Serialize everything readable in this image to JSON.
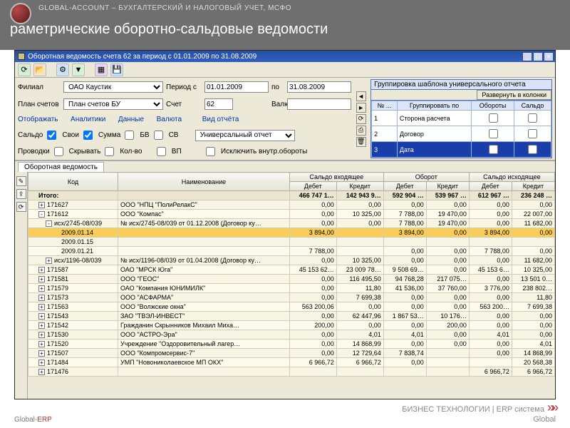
{
  "page": {
    "header": "GLOBAL-ACCOUNT – БУХГАЛТЕРСКИЙ И НАЛОГОВЫЙ УЧЕТ, МСФО",
    "title": "раметрические оборотно-сальдовые ведомости",
    "footer_left_a": "Global-",
    "footer_left_b": "ERP",
    "footer_right_a": "БИЗНЕС ТЕХНОЛОГИИ | ERP система",
    "footer_right_b": "Global"
  },
  "window": {
    "title": "Оборотная ведомость счета 62  за период с 01.01.2009 по 31.08.2009"
  },
  "filters": {
    "filial_label": "Филиал",
    "filial_value": "ОАО Каустик",
    "plan_label": "План счетов",
    "plan_value": "План счетов БУ",
    "period_s_label": "Период с",
    "period_s_value": "01.01.2009",
    "po_label": "по",
    "po_value": "31.08.2009",
    "schet_label": "Счет",
    "schet_value": "62",
    "valuta_label": "Валюта",
    "valuta_value": "",
    "otobrazhat_label": "Отображать",
    "analitiki_label": "Аналитики",
    "dannye_label": "Данные",
    "valuta2_label": "Валюта",
    "vid_otcheta_label": "Вид отчёта",
    "vid_otcheta_value": "Универсальный отчет",
    "saldo_label": "Сальдо",
    "svoi_label": "Свои",
    "summa_label": "Сумма",
    "bv_label": "БВ",
    "sv_label": "СВ",
    "provodki_label": "Проводки",
    "skryvat_label": "Скрывать",
    "kolvo_label": "Кол-во",
    "vp_label": "ВП",
    "isklyuchit_label": "Исключить внутр.обороты"
  },
  "group": {
    "title": "Группировка шаблона универсального отчета",
    "expand_btn": "Развернуть в колонки",
    "cols": {
      "no": "№ ...",
      "group_by": "Группировать по",
      "oboroty": "Обороты",
      "saldo": "Сальдо"
    },
    "rows": [
      {
        "no": "1",
        "name": "Сторона расчета",
        "ob": false,
        "sa": false,
        "sel": false
      },
      {
        "no": "2",
        "name": "Договор",
        "ob": false,
        "sa": false,
        "sel": false
      },
      {
        "no": "3",
        "name": "Дата",
        "ob": false,
        "sa": false,
        "sel": true
      }
    ]
  },
  "arrows": {
    "up": "◄",
    "down": "►",
    "refresh": "⟳",
    "export": "⎙",
    "del": "🗑"
  },
  "tab": {
    "name": "Оборотная ведомость"
  },
  "table": {
    "headers": {
      "kod": "Код",
      "naim": "Наименование",
      "saldo_in": "Сальдо входящее",
      "oborot": "Оборот",
      "saldo_out": "Сальдо исходящее",
      "debet": "Дебет",
      "kredit": "Кредит"
    },
    "rows": [
      {
        "t": "total",
        "code": "Итого:",
        "name": "",
        "d1": "466 747 1…",
        "k1": "142 943 9…",
        "d2": "592 904 …",
        "k2": "539 967 …",
        "d3": "612 967 …",
        "k3": "236 248 …"
      },
      {
        "t": "n",
        "i": 0,
        "pm": "+",
        "code": "171627",
        "name": "ООО \"НПЦ \"ПолиРелакС\"",
        "d1": "0,00",
        "k1": "0,00",
        "d2": "0,00",
        "k2": "0,00",
        "d3": "0,00",
        "k3": "0,00"
      },
      {
        "t": "n",
        "i": 0,
        "pm": "-",
        "code": "171612",
        "name": "ООО \"Компас\"",
        "d1": "0,00",
        "k1": "10 325,00",
        "d2": "7 788,00",
        "k2": "19 470,00",
        "d3": "0,00",
        "k3": "22 007,00"
      },
      {
        "t": "n",
        "i": 1,
        "pm": "-",
        "code": "исх/2745-08/039",
        "name": "№ исх/2745-08/039 от 01.12.2008 (Договор ку…",
        "d1": "0,00",
        "k1": "0,00",
        "d2": "7 788,00",
        "k2": "19 470,00",
        "d3": "0,00",
        "k3": "11 682,00"
      },
      {
        "t": "hl",
        "i": 2,
        "code": "2009.01.14",
        "name": "",
        "d1": "3 894,00",
        "k1": "",
        "d2": "3 894,00",
        "k2": "0,00",
        "d3": "3 894,00",
        "k3": "0,00"
      },
      {
        "t": "n",
        "i": 2,
        "code": "2009.01.15",
        "name": "",
        "d1": "",
        "k1": "",
        "d2": "",
        "k2": "",
        "d3": "",
        "k3": ""
      },
      {
        "t": "n",
        "i": 2,
        "code": "2009.01.21",
        "name": "",
        "d1": "7 788,00",
        "k1": "",
        "d2": "0,00",
        "k2": "0,00",
        "d3": "7 788,00",
        "k3": "0,00"
      },
      {
        "t": "n",
        "i": 1,
        "pm": "+",
        "code": "исх/1196-08/039",
        "name": "№ исх/1196-08/039 от 01.04.2008 (Договор ку…",
        "d1": "0,00",
        "k1": "10 325,00",
        "d2": "0,00",
        "k2": "0,00",
        "d3": "0,00",
        "k3": "11 682,00"
      },
      {
        "t": "n",
        "i": 0,
        "pm": "+",
        "code": "171587",
        "name": "ОАО \"МРСК Юга\"",
        "d1": "45 153 62…",
        "k1": "23 009 78…",
        "d2": "9 508 69…",
        "k2": "0,00",
        "d3": "45 153 6…",
        "k3": "10 325,00"
      },
      {
        "t": "n",
        "i": 0,
        "pm": "+",
        "code": "171581",
        "name": "ООО \"ГЕОС\"",
        "d1": "0,00",
        "k1": "116 495,50",
        "d2": "94 768,28",
        "k2": "217 075…",
        "d3": "0,00",
        "k3": "13 501 0…"
      },
      {
        "t": "n",
        "i": 0,
        "pm": "+",
        "code": "171579",
        "name": "ОАО \"Компания ЮНИМИЛК\"",
        "d1": "0,00",
        "k1": "11,80",
        "d2": "41 536,00",
        "k2": "37 760,00",
        "d3": "3 776,00",
        "k3": "238 802…"
      },
      {
        "t": "n",
        "i": 0,
        "pm": "+",
        "code": "171573",
        "name": "ООО \"АСФАРМА\"",
        "d1": "0,00",
        "k1": "7 699,38",
        "d2": "0,00",
        "k2": "0,00",
        "d3": "0,00",
        "k3": "11,80"
      },
      {
        "t": "n",
        "i": 0,
        "pm": "+",
        "code": "171563",
        "name": "ООО \"Волжские окна\"",
        "d1": "563 200,06",
        "k1": "0,00",
        "d2": "0,00",
        "k2": "0,00",
        "d3": "563 200…",
        "k3": "7 699,38"
      },
      {
        "t": "n",
        "i": 0,
        "pm": "+",
        "code": "171543",
        "name": "ЗАО \"ТВЭЛ-ИНВЕСТ\"",
        "d1": "0,00",
        "k1": "62 447,96",
        "d2": "1 867 53…",
        "k2": "10 176…",
        "d3": "0,00",
        "k3": "0,00"
      },
      {
        "t": "n",
        "i": 0,
        "pm": "+",
        "code": "171542",
        "name": "Гражданин Скрынников Михаил  Миха…",
        "d1": "200,00",
        "k1": "0,00",
        "d2": "0,00",
        "k2": "200,00",
        "d3": "0,00",
        "k3": "0,00"
      },
      {
        "t": "n",
        "i": 0,
        "pm": "+",
        "code": "171530",
        "name": "ООО \"АСТРО-Эра\"",
        "d1": "0,00",
        "k1": "4,01",
        "d2": "4,01",
        "k2": "0,00",
        "d3": "4,01",
        "k3": "0,00"
      },
      {
        "t": "n",
        "i": 0,
        "pm": "+",
        "code": "171520",
        "name": "Учреждение \"Оздоровительный лагер…",
        "d1": "0,00",
        "k1": "14 868,99",
        "d2": "0,00",
        "k2": "0,00",
        "d3": "0,00",
        "k3": "4,01"
      },
      {
        "t": "n",
        "i": 0,
        "pm": "+",
        "code": "171507",
        "name": "ООО \"Компромсервис-7\"",
        "d1": "0,00",
        "k1": "12 729,64",
        "d2": "7 838,74",
        "k2": "",
        "d3": "0,00",
        "k3": "14 868,99"
      },
      {
        "t": "n",
        "i": 0,
        "pm": "+",
        "code": "171484",
        "name": "УМП \"Новониколаевское МП ОКХ\"",
        "d1": "6 966,72",
        "k1": "6 966,72",
        "d2": "0,00",
        "k2": "",
        "d3": "",
        "k3": "20 568,38"
      },
      {
        "t": "n",
        "i": 0,
        "pm": "+",
        "code": "171476",
        "name": "",
        "d1": "",
        "k1": "",
        "d2": "",
        "k2": "",
        "d3": "6 966,72",
        "k3": "6 966,72"
      }
    ]
  }
}
